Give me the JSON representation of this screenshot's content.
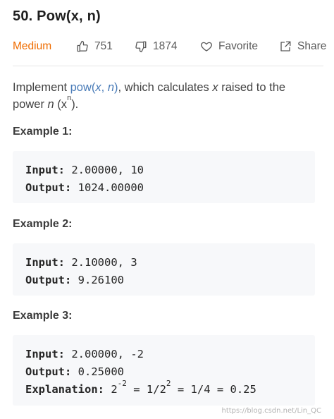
{
  "problem": {
    "title": "50. Pow(x, n)",
    "difficulty": "Medium",
    "likes": "751",
    "dislikes": "1874",
    "favorite_label": "Favorite",
    "share_label": "Share"
  },
  "description": {
    "prefix": "Implement ",
    "func_name": "pow(",
    "arg_x": "x",
    "comma": ", ",
    "arg_n": "n",
    "func_close": ")",
    "middle": ", which calculates ",
    "var_x": "x",
    "suffix1": " raised to the",
    "line2_start": "power ",
    "var_n": "n",
    "paren_open": " (x",
    "sup_n": "n",
    "paren_close": ")."
  },
  "examples": [
    {
      "heading": "Example 1:",
      "input_label": "Input:",
      "input_value": " 2.00000, 10",
      "output_label": "Output:",
      "output_value": " 1024.00000"
    },
    {
      "heading": "Example 2:",
      "input_label": "Input:",
      "input_value": " 2.10000, 3",
      "output_label": "Output:",
      "output_value": " 9.26100"
    },
    {
      "heading": "Example 3:",
      "input_label": "Input:",
      "input_value": " 2.00000, -2",
      "output_label": "Output:",
      "output_value": " 0.25000",
      "explanation_label": "Explanation:",
      "exp_base1": " 2",
      "exp_sup1": "-2",
      "exp_mid": " = 1/2",
      "exp_sup2": "2",
      "exp_end": " = 1/4 = 0.25"
    }
  ],
  "watermark": "https://blog.csdn.net/Lin_QC",
  "colors": {
    "difficulty": "#ef6c00",
    "code_inline": "#4a7cb8",
    "code_bg": "#f7f8fa"
  },
  "icons": [
    "thumbs-up-icon",
    "thumbs-down-icon",
    "heart-icon",
    "share-icon"
  ]
}
